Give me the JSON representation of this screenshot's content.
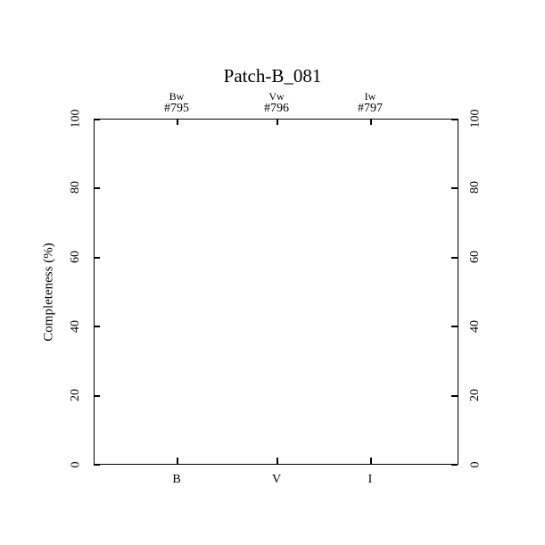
{
  "chart_data": {
    "type": "bar",
    "title": "Patch-B_081",
    "ylabel": "Completeness (%)",
    "xlabel": "",
    "ylim": [
      0,
      100
    ],
    "categories": [
      "B",
      "V",
      "I"
    ],
    "top_filters": [
      "Bw",
      "Vw",
      "Iw"
    ],
    "top_ids": [
      "#795",
      "#796",
      "#797"
    ],
    "values": [
      null,
      null,
      null
    ],
    "yticks": [
      0,
      20,
      40,
      60,
      80,
      100
    ]
  }
}
